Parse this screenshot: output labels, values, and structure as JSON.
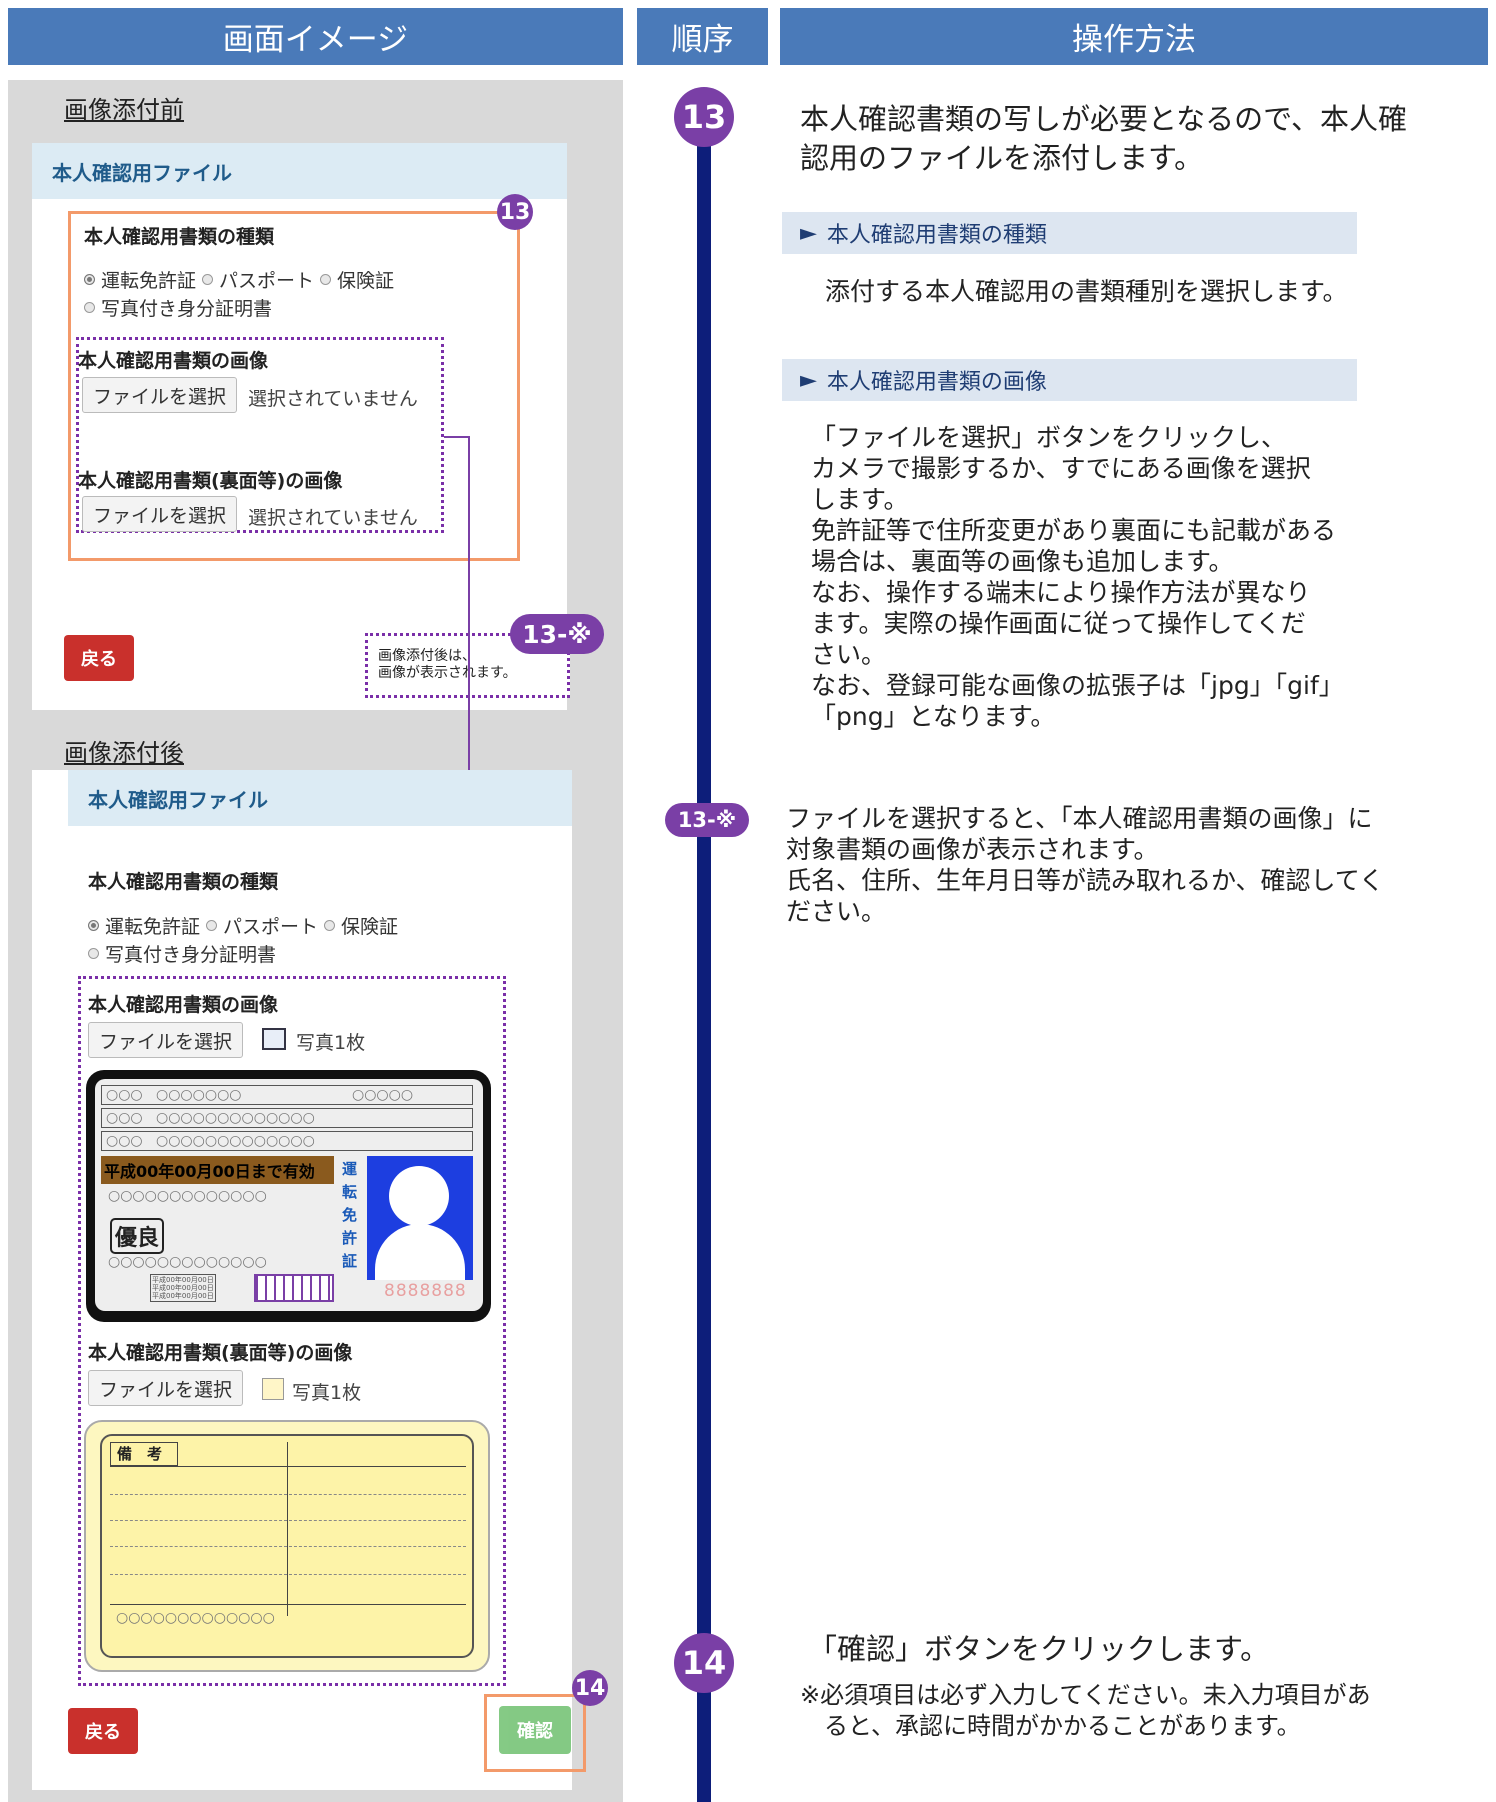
{
  "headers": {
    "screen": "画面イメージ",
    "order": "順序",
    "method": "操作方法"
  },
  "before": {
    "section_title": "画像添付前",
    "card_title": "本人確認用ファイル",
    "type_label": "本人確認用書類の種類",
    "radio_options": [
      "運転免許証",
      "パスポート",
      "保険証",
      "写真付き身分証明書"
    ],
    "image_label": "本人確認用書類の画像",
    "file_button": "ファイルを選択",
    "no_file": "選択されていません",
    "back_image_label": "本人確認用書類(裏面等)の画像",
    "back_file_button": "ファイルを選択",
    "back_no_file": "選択されていません",
    "back_button": "戻る",
    "badge": "13",
    "note_badge": "13-※",
    "note_text": "画像添付後は、\n画像が表示されます。"
  },
  "after": {
    "section_title": "画像添付後",
    "card_title": "本人確認用ファイル",
    "type_label": "本人確認用書類の種類",
    "radio_options": [
      "運転免許証",
      "パスポート",
      "保険証",
      "写真付き身分証明書"
    ],
    "image_label": "本人確認用書類の画像",
    "file_button": "ファイルを選択",
    "file_count": "写真1枚",
    "back_image_label": "本人確認用書類(裏面等)の画像",
    "back_file_button": "ファイルを選択",
    "back_file_count": "写真1枚",
    "back_button": "戻る",
    "confirm_button": "確認",
    "badge": "14"
  },
  "license_front": {
    "row1_a": "○○○",
    "row1_b": "○○○○○○○",
    "row1_c": "○○○○○",
    "row2_a": "○○○",
    "row2_b": "○○○○○○○○○○○○○",
    "row3_a": "○○○",
    "row3_b": "○○○○○○○○○○○○○",
    "expiry": "平成00年00月00日まで有効",
    "line_a": "○○○○○○○○○○○○○",
    "grade": "優良",
    "line_b": "○○○○○○○○○○○○○",
    "dates": [
      "平成00年00月00日",
      "平成00年00月00日",
      "平成00年00月00日"
    ],
    "vertical": "運転免許証",
    "number": "8888888"
  },
  "license_back": {
    "remarks": "備　考",
    "footer": "○○○○○○○○○○○○○"
  },
  "steps": {
    "s13": {
      "badge": "13",
      "text": "本人確認書類の写しが必要となるので、本人確\n認用のファイルを添付します。",
      "sub1_title": "本人確認用書類の種類",
      "sub1_text": "添付する本人確認用の書類種別を選択します。",
      "sub2_title": "本人確認用書類の画像",
      "sub2_text": "「ファイルを選択」ボタンをクリックし、\nカメラで撮影するか、すでにある画像を選択\nします。\n免許証等で住所変更があり裏面にも記載がある\n場合は、裏面等の画像も追加します。\nなお、操作する端末により操作方法が異なり\nます。実際の操作画面に従って操作してくだ\nさい。\nなお、登録可能な画像の拡張子は「jpg」「gif」\n「png」となります。"
    },
    "s13note": {
      "badge": "13-※",
      "text": "ファイルを選択すると、「本人確認用書類の画像」に\n対象書類の画像が表示されます。\n氏名、住所、生年月日等が読み取れるか、確認してく\nださい。"
    },
    "s14": {
      "badge": "14",
      "text": "「確認」ボタンをクリックします。",
      "note": "※必須項目は必ず入力してください。未入力項目があ\n　ると、承認に時間がかかることがあります。"
    }
  },
  "colors": {
    "header": "#4a7ab9",
    "accent": "#7a3fa6",
    "timeline": "#0d1e7a",
    "highlight": "#f39a6a"
  }
}
